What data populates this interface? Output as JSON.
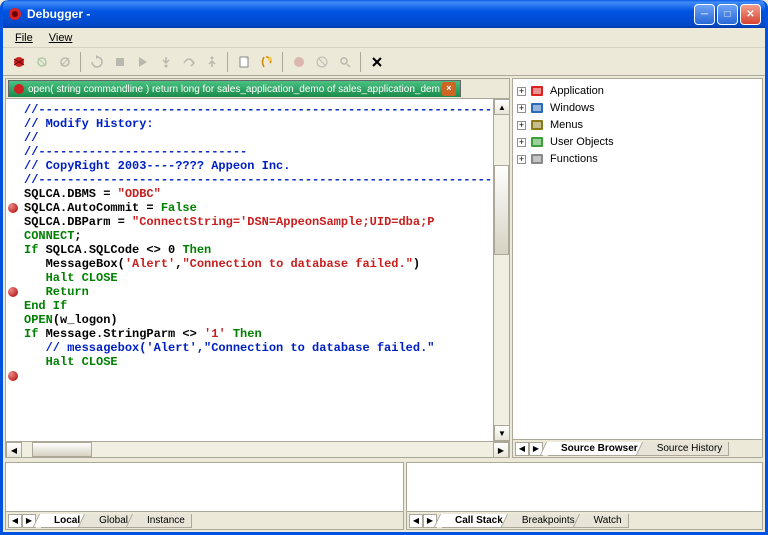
{
  "title": "Debugger -",
  "menu": {
    "file": "File",
    "view": "View"
  },
  "toolbar_icons": [
    "start-debug",
    "attach",
    "detach",
    "|",
    "restart",
    "stop",
    "continue",
    "step-into",
    "step-over",
    "step-out",
    "|",
    "new",
    "set-next",
    "|",
    "toggle-bp",
    "clear-bp",
    "find",
    "|",
    "close"
  ],
  "code_tab": {
    "label": "open( string commandline  ) return long for sales_application_demo of sales_application_dem",
    "close": "×"
  },
  "breakpoints_at": [
    8,
    14,
    20
  ],
  "code_lines": [
    {
      "t": "//---------------------------------------------------------------",
      "cls": "c-comm"
    },
    {
      "t": "// Modify History:",
      "cls": "c-comm"
    },
    {
      "t": "//",
      "cls": "c-comm"
    },
    {
      "t": "//-----------------------------",
      "cls": "c-comm"
    },
    {
      "t": "// CopyRight 2003----???? Appeon Inc.",
      "cls": "c-comm"
    },
    {
      "t": "//---------------------------------------------------------------",
      "cls": "c-comm"
    },
    {
      "t": "",
      "cls": ""
    },
    {
      "t": "SQLCA.DBMS = ",
      "cls": "c-id",
      "append": [
        {
          "t": "\"ODBC\"",
          "cls": "c-str"
        }
      ]
    },
    {
      "t": "SQLCA.AutoCommit = ",
      "cls": "c-id",
      "append": [
        {
          "t": "False",
          "cls": "c-key"
        }
      ]
    },
    {
      "t": "SQLCA.DBParm = ",
      "cls": "c-id",
      "append": [
        {
          "t": "\"ConnectString='DSN=AppeonSample;UID=dba;P",
          "cls": "c-str"
        }
      ]
    },
    {
      "t": "CONNECT",
      "cls": "c-key",
      "append": [
        {
          "t": ";",
          "cls": "c-id"
        }
      ]
    },
    {
      "t": "",
      "cls": ""
    },
    {
      "t": "If",
      "cls": "c-key",
      "append": [
        {
          "t": " SQLCA.SQLCode <> ",
          "cls": "c-id"
        },
        {
          "t": "0",
          "cls": "c-num"
        },
        {
          "t": " ",
          "cls": "c-id"
        },
        {
          "t": "Then",
          "cls": "c-key"
        }
      ]
    },
    {
      "t": "   MessageBox(",
      "cls": "c-id",
      "append": [
        {
          "t": "'Alert'",
          "cls": "c-str"
        },
        {
          "t": ",",
          "cls": "c-id"
        },
        {
          "t": "\"Connection to database failed.\"",
          "cls": "c-str"
        },
        {
          "t": ")",
          "cls": "c-id"
        }
      ]
    },
    {
      "t": "   Halt CLOSE",
      "cls": "c-key"
    },
    {
      "t": "   Return",
      "cls": "c-key"
    },
    {
      "t": "End If",
      "cls": "c-key"
    },
    {
      "t": "",
      "cls": ""
    },
    {
      "t": "OPEN",
      "cls": "c-key",
      "append": [
        {
          "t": "(w_logon)",
          "cls": "c-id"
        }
      ]
    },
    {
      "t": "If",
      "cls": "c-key",
      "append": [
        {
          "t": " Message.StringParm <> ",
          "cls": "c-id"
        },
        {
          "t": "'1'",
          "cls": "c-str"
        },
        {
          "t": " ",
          "cls": "c-id"
        },
        {
          "t": "Then",
          "cls": "c-key"
        }
      ]
    },
    {
      "t": "   // messagebox('Alert',\"Connection to database failed.\"",
      "cls": "c-comm"
    },
    {
      "t": "   Halt CLOSE",
      "cls": "c-key"
    }
  ],
  "tree": [
    {
      "icon": "app",
      "label": "Application",
      "color": "#d22"
    },
    {
      "icon": "win",
      "label": "Windows",
      "color": "#2a6ab8"
    },
    {
      "icon": "menu",
      "label": "Menus",
      "color": "#8a7a1a"
    },
    {
      "icon": "uobj",
      "label": "User Objects",
      "color": "#3aa03a"
    },
    {
      "icon": "func",
      "label": "Functions",
      "color": "#888"
    }
  ],
  "right_tabs": {
    "active": "Source Browser",
    "other": "Source History"
  },
  "bottom_left_tabs": [
    "Local",
    "Global",
    "Instance"
  ],
  "bottom_right_tabs": [
    "Call Stack",
    "Breakpoints",
    "Watch"
  ]
}
